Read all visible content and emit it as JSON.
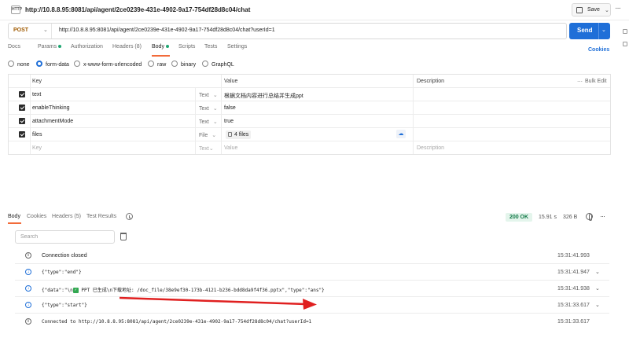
{
  "title_bar": {
    "method_badge": "HTTP",
    "url": "http://10.8.8.95:8081/api/agent/2ce0239e-431e-4902-9a17-754df28d8c04/chat",
    "save_label": "Save"
  },
  "request": {
    "method": "POST",
    "url": "http://10.8.8.95:8081/api/agent/2ce0239e-431e-4902-9a17-754df28d8c04/chat?userId=1",
    "send_label": "Send"
  },
  "tabs": [
    {
      "label": "Docs"
    },
    {
      "label": "Params",
      "dot": true
    },
    {
      "label": "Authorization"
    },
    {
      "label": "Headers (8)"
    },
    {
      "label": "Body",
      "dot": true,
      "active": true
    },
    {
      "label": "Scripts"
    },
    {
      "label": "Tests"
    },
    {
      "label": "Settings"
    }
  ],
  "cookies_label": "Cookies",
  "body_types": [
    {
      "label": "none",
      "selected": false
    },
    {
      "label": "form-data",
      "selected": true
    },
    {
      "label": "x-www-form-urlencoded",
      "selected": false
    },
    {
      "label": "raw",
      "selected": false
    },
    {
      "label": "binary",
      "selected": false
    },
    {
      "label": "GraphQL",
      "selected": false
    }
  ],
  "table": {
    "headers": {
      "key": "Key",
      "value": "Value",
      "description": "Description",
      "bulk_edit": "Bulk Edit"
    },
    "rows": [
      {
        "key": "text",
        "type": "Text",
        "value": "根据文档内容进行总结并生成ppt"
      },
      {
        "key": "enableThinking",
        "type": "Text",
        "value": "false"
      },
      {
        "key": "attachmentMode",
        "type": "Text",
        "value": "true"
      },
      {
        "key": "files",
        "type": "File",
        "value": "4 files"
      }
    ],
    "placeholder": {
      "key": "Key",
      "type": "Text",
      "value": "Value",
      "description": "Description"
    }
  },
  "response": {
    "tabs": [
      {
        "label": "Body",
        "active": true
      },
      {
        "label": "Cookies"
      },
      {
        "label": "Headers (5)"
      },
      {
        "label": "Test Results"
      }
    ],
    "status": "200 OK",
    "time": "15.91 s",
    "size": "326 B",
    "search_placeholder": "Search",
    "messages": [
      {
        "text": "Connection closed",
        "time": "15:31:41.993",
        "kind": "info",
        "chevron": false
      },
      {
        "text": "{\"type\":\"end\"}",
        "time": "15:31:41.947",
        "kind": "down",
        "chevron": true
      },
      {
        "text_before": "{\"data\":\"\\n",
        "text_after": " PPT 已生成\\n下载地址: /doc_file/38e9ef30-173b-4121-b236-bdd8da9f4f36.pptx\",\"type\":\"ans\"}",
        "time": "15:31:41.938",
        "kind": "down",
        "chevron": true
      },
      {
        "text": "{\"type\":\"start\"}",
        "time": "15:31:33.617",
        "kind": "down",
        "chevron": true
      },
      {
        "text": "Connected to http://10.8.8.95:8081/api/agent/2ce0239e-431e-4902-9a17-754df28d8c04/chat?userId=1",
        "time": "15:31:33.617",
        "kind": "info",
        "chevron": false
      }
    ]
  },
  "colors": {
    "accent": "#1f6fd8",
    "tab_underline": "#f26b3a",
    "method": "#a05a00",
    "status_ok_bg": "#e4f5ec",
    "status_ok_text": "#137a48",
    "annotation_arrow": "#e02020"
  },
  "icons": {
    "save": "save-icon",
    "send_dropdown": "chevron-down-icon",
    "history": "history-icon",
    "globe": "globe-icon",
    "trash": "trash-icon",
    "info": "info-icon",
    "incoming": "arrow-down-icon",
    "checkmark": "checkmark-emoji-icon"
  }
}
